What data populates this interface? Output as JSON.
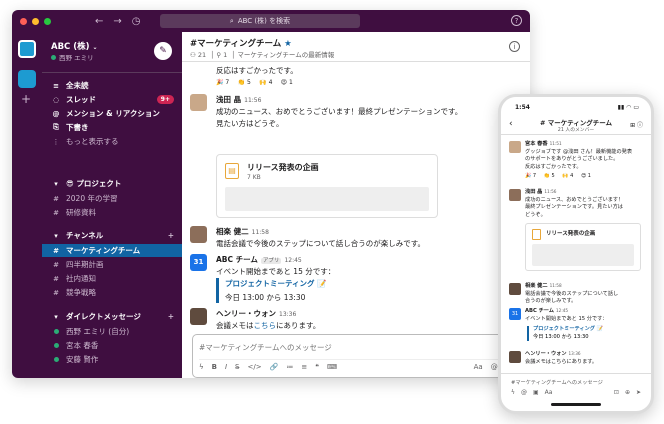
{
  "search": {
    "label": "ABC (株) を検索"
  },
  "workspace": {
    "name": "ABC (株)",
    "user": "西野 エミリ"
  },
  "sidebar": {
    "top": [
      {
        "icon": "≡",
        "label": "全未読",
        "bold": true
      },
      {
        "icon": "◌",
        "label": "スレッド",
        "bold": true,
        "badge": "9+"
      },
      {
        "icon": "@",
        "label": "メンション & リアクション",
        "bold": true
      },
      {
        "icon": "⎘",
        "label": "下書き",
        "bold": true
      },
      {
        "icon": "⋮",
        "label": "もっと表示する",
        "bold": false
      }
    ],
    "project_section": "😎 プロジェクト",
    "project_channels": [
      "2020 年の学習",
      "研修資料"
    ],
    "channels_section": "チャンネル",
    "channels": [
      "マーケティングチーム",
      "四半期計画",
      "社内通知",
      "競争戦略"
    ],
    "dm_section": "ダイレクトメッセージ",
    "dms": [
      "西野 エミリ (自分)",
      "宮本 春香",
      "安藤 賢作"
    ]
  },
  "channel": {
    "title": "#マーケティングチーム",
    "star": "★",
    "members": "21",
    "pins": "1",
    "topic": "マーケティングチームの最新情報"
  },
  "messages": {
    "top_text": "反応はすごかったです。",
    "reactions": [
      "🎉 7",
      "👏 5",
      "🙌 4",
      "😍 1"
    ],
    "m1": {
      "name": "浅田 晶",
      "time": "11:56",
      "text1": "成功のニュース、おめでとうございます！最終プレゼンテーションです。",
      "text2": "見たい方はどうぞ。"
    },
    "file": {
      "name": "リリース発表の企画",
      "size": "7 KB"
    },
    "m2": {
      "name": "相楽 健二",
      "time": "11:58",
      "text": "電話会議で今後のステップについて話し合うのが楽しみです。"
    },
    "m3": {
      "name": "ABC チーム",
      "tag": "アプリ",
      "time": "12:45",
      "text": "イベント開始まであと 15 分です：",
      "event_title": "プロジェクトミーティング 📝",
      "event_time": "今日 13:00 から 13:30",
      "avatar": "31"
    },
    "m4": {
      "name": "ヘンリー・ウォン",
      "time": "13:36",
      "text_pre": "会議メモは",
      "link": "こちら",
      "text_post": "にあります。"
    }
  },
  "composer": {
    "placeholder": "#マーケティングチームへのメッセージ",
    "tools": [
      "ϟ",
      "B",
      "I",
      "S̶",
      "</>",
      "🔗",
      "≔",
      "≡",
      "❝",
      "⌨"
    ],
    "right_tools": [
      "Aa",
      "@",
      "☺"
    ]
  },
  "phone": {
    "time": "1:54",
    "status_icons": "▮▮ ◠ ▭",
    "title": "# マーケティングチーム",
    "subtitle": "21 人のメンバー",
    "head_icons": "⊞ ⓘ",
    "m0": {
      "name": "宮本 春香",
      "time": "11:51",
      "l1": "グッジョブです @浅田 さん！最新機能の発表",
      "l2": "のサポートをありがとうございました。",
      "l3": "反応はすごかったです。"
    },
    "reactions": [
      "🎉 7",
      "👏 5",
      "🙌 4",
      "😍 1"
    ],
    "m1": {
      "name": "浅田 晶",
      "time": "11:56",
      "l1": "成功のニュース、おめでとうございます！",
      "l2": "最終プレゼンテーションです。見たい方は",
      "l3": "どうぞ。"
    },
    "file": {
      "name": "リリース発表の企画"
    },
    "m2": {
      "name": "相楽 健二",
      "time": "11:58",
      "l1": "電話会議で今後のステップについて話し",
      "l2": "合うのが楽しみです。"
    },
    "m3": {
      "name": "ABC チーム",
      "time": "12:45",
      "l1": "イベント開始まであと 15 分です：",
      "event_title": "プロジェクトミーティング 📝",
      "event_time": "今日 13:00 から 13:30",
      "avatar": "31"
    },
    "m4": {
      "name": "ヘンリー・ウォン",
      "time": "13:36",
      "l1": "会議メモはこちらにあります。"
    },
    "composer_placeholder": "#マーケティングチームへのメッセージ",
    "tools": [
      "ϟ",
      "@",
      "▣",
      "Aa"
    ],
    "right_tools": [
      "⊡",
      "⊕",
      "➤"
    ]
  },
  "colors": {
    "sidebar": "#3f0e40",
    "active": "#1164a3",
    "badge": "#cd2553",
    "link": "#1264a3"
  }
}
